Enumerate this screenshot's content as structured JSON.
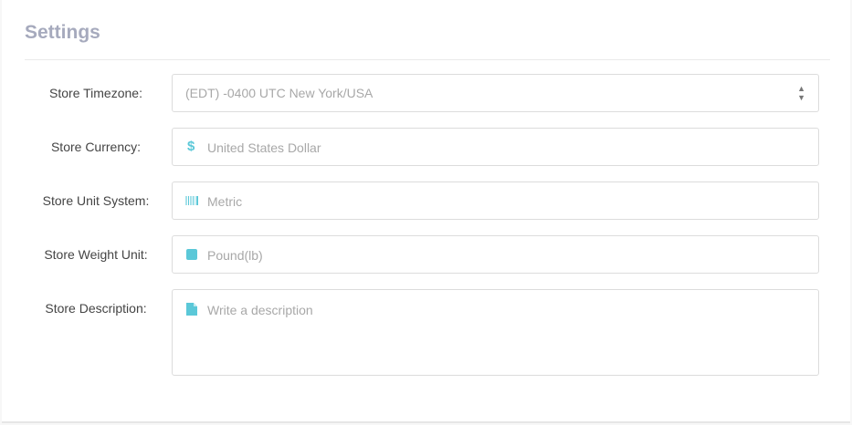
{
  "title": "Settings",
  "fields": [
    {
      "label": "Store Timezone:",
      "value": "(EDT) -0400 UTC New York/USA",
      "icon": "select-arrows-icon"
    },
    {
      "label": "Store Currency:",
      "placeholder": "United States Dollar",
      "icon": "dollar-icon"
    },
    {
      "label": "Store Unit System:",
      "placeholder": "Metric",
      "icon": "barcode-icon"
    },
    {
      "label": "Store Weight Unit:",
      "placeholder": "Pound(lb)",
      "icon": "square-icon"
    },
    {
      "label": "Store Description:",
      "placeholder": "Write a description",
      "icon": "file-icon"
    }
  ],
  "colors": {
    "accent": "#5bc8d8",
    "title": "#a6aabd"
  }
}
